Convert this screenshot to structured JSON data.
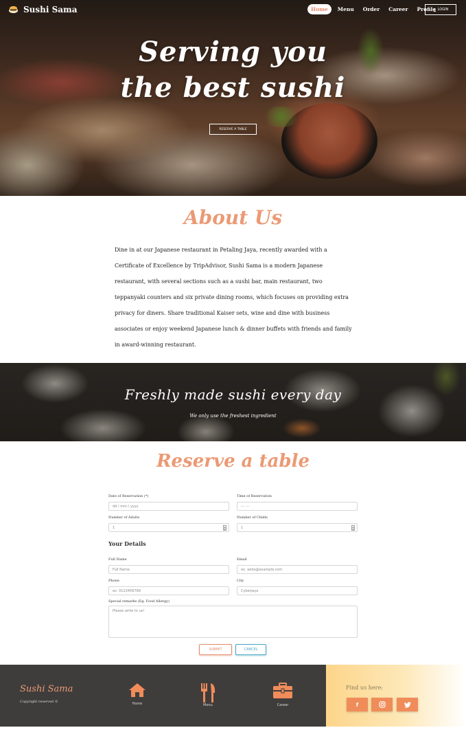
{
  "header": {
    "brand": "Sushi Sama",
    "nav": [
      {
        "label": "Home",
        "active": true
      },
      {
        "label": "Menu",
        "active": false
      },
      {
        "label": "Order",
        "active": false
      },
      {
        "label": "Career",
        "active": false
      },
      {
        "label": "Profile",
        "active": false
      }
    ],
    "login_label": "LOGIN"
  },
  "hero": {
    "title_line1": "Serving you",
    "title_line2": "the best sushi",
    "button_label": "RESERVE A TABLE"
  },
  "about": {
    "title": "About Us",
    "text": "Dine in at our Japanese restaurant in Petaling Jaya, recently awarded with a Certificate of Excellence by TripAdvisor, Sushi Sama is a modern Japanese restaurant, with several sections such as a sushi bar, main restaurant, two teppanyaki counters and six private dining rooms, which focuses on providing extra privacy for diners. Share traditional Kaiser sets, wine and dine with business associates or enjoy weekend Japanese lunch & dinner buffets with friends and family in award-winning restaurant."
  },
  "banner": {
    "title": "Freshly made sushi every day",
    "subtitle": "We only use the freshest ingredient"
  },
  "reserve": {
    "title": "Reserve a table",
    "date_label": "Date of Reservation (*)",
    "date_placeholder": "dd / mm / yyyy",
    "time_label": "Time of Reservation",
    "time_placeholder": "-- : --",
    "adults_label": "Number of Adults",
    "adults_value": "1",
    "children_label": "Number of Childs",
    "children_value": "1",
    "details_heading": "Your Details",
    "fullname_label": "Full Name",
    "fullname_placeholder": "Full Name",
    "email_label": "Email",
    "email_placeholder": "ex. aeda@example.com",
    "phone_label": "Phone",
    "phone_placeholder": "ex. 0123456789",
    "city_label": "City",
    "city_placeholder": "Cyberjaya",
    "remarks_label": "Special remarks (Eg. Food Allergy)",
    "remarks_placeholder": "Please write to us!",
    "submit_label": "SUBMIT",
    "cancel_label": "CANCEL"
  },
  "footer": {
    "brand": "Sushi Sama",
    "copyright": "Copyright reserved ©",
    "links": [
      {
        "label": "Home",
        "icon": "home-icon"
      },
      {
        "label": "Menu",
        "icon": "utensils-icon"
      },
      {
        "label": "Career",
        "icon": "briefcase-icon"
      }
    ],
    "find_us": "Find us here:",
    "social": [
      {
        "label": "f",
        "icon": "facebook-icon"
      },
      {
        "label": "◎",
        "icon": "instagram-icon"
      },
      {
        "label": "🐦",
        "icon": "twitter-icon"
      }
    ]
  },
  "colors": {
    "accent": "#eb9a75",
    "footer_dark": "#3f3d3c",
    "cancel": "#4aa8c4"
  }
}
